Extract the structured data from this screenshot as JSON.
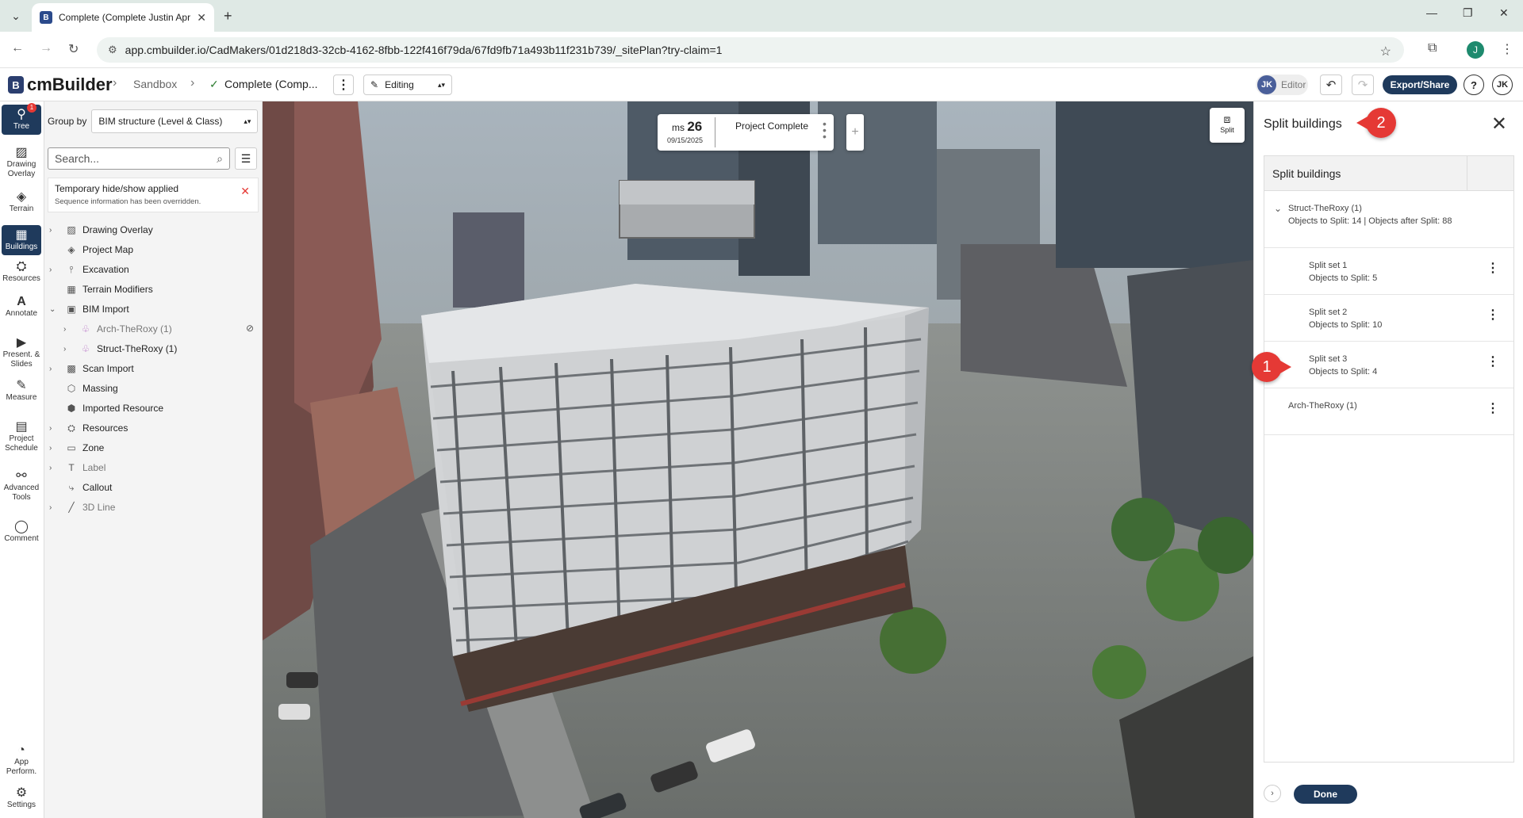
{
  "browser": {
    "tab_title": "Complete (Complete Justin Apr",
    "url": "app.cmbuilder.io/CadMakers/01d218d3-32cb-4162-8fbb-122f416f79da/67fd9fb71a493b11f231b739/_sitePlan?try-claim=1",
    "profile_initial": "J"
  },
  "app": {
    "logo_text": "cmBuilder",
    "logo_mark": "B",
    "breadcrumb": [
      "Sandbox",
      "Complete (Comp..."
    ],
    "mode": "Editing",
    "user_initials": "JK",
    "user_role": "Editor",
    "export_label": "Export/Share",
    "help_label": "?"
  },
  "rail": {
    "items": [
      {
        "label": "Tree",
        "badge": "1"
      },
      {
        "label": "Drawing Overlay"
      },
      {
        "label": "Terrain"
      },
      {
        "label": "Buildings"
      },
      {
        "label": "Resources"
      },
      {
        "label": "Annotate"
      },
      {
        "label": "Present. & Slides"
      },
      {
        "label": "Measure"
      },
      {
        "label": "Project Schedule"
      },
      {
        "label": "Advanced Tools"
      },
      {
        "label": "Comment"
      },
      {
        "label": "App Perform."
      },
      {
        "label": "Settings"
      }
    ]
  },
  "tree": {
    "group_by_label": "Group by",
    "group_by_value": "BIM structure (Level & Class)",
    "search_placeholder": "Search...",
    "notice_title": "Temporary hide/show applied",
    "notice_subtitle": "Sequence information has been overridden.",
    "rows": [
      {
        "label": "Drawing Overlay",
        "icon": "image-icon"
      },
      {
        "label": "Project Map",
        "icon": "layers-icon"
      },
      {
        "label": "Excavation",
        "icon": "shovel-icon"
      },
      {
        "label": "Terrain Modifiers",
        "icon": "grid-icon"
      },
      {
        "label": "BIM Import",
        "icon": "cube-icon"
      },
      {
        "label": "Arch-TheRoxy (1)",
        "icon": "model-icon"
      },
      {
        "label": "Struct-TheRoxy (1)",
        "icon": "model-icon"
      },
      {
        "label": "Scan Import",
        "icon": "scan-icon"
      },
      {
        "label": "Massing",
        "icon": "massing-icon"
      },
      {
        "label": "Imported Resource",
        "icon": "resource-icon"
      },
      {
        "label": "Resources",
        "icon": "resources-icon"
      },
      {
        "label": "Zone",
        "icon": "zone-icon"
      },
      {
        "label": "Label",
        "icon": "label-icon"
      },
      {
        "label": "Callout",
        "icon": "callout-icon"
      },
      {
        "label": "3D Line",
        "icon": "line-icon"
      }
    ]
  },
  "view": {
    "seq_prefix": "ms",
    "seq_number": "26",
    "seq_date": "09/15/2025",
    "seq_phase": "Project Complete",
    "split_label": "Split"
  },
  "split_panel": {
    "title": "Split buildings",
    "table_header": "Split buildings",
    "group_name": "Struct-TheRoxy (1)",
    "group_detail": "Objects to Split: 14 | Objects after Split: 88",
    "sets": [
      {
        "name": "Split set 1",
        "detail": "Objects to Split: 5"
      },
      {
        "name": "Split set 2",
        "detail": "Objects to Split: 10"
      },
      {
        "name": "Split set 3",
        "detail": "Objects to Split: 4"
      }
    ],
    "other_group": "Arch-TheRoxy (1)",
    "done_label": "Done"
  },
  "callouts": [
    "1",
    "2"
  ],
  "colors": {
    "accent": "#1f3a5c",
    "callout": "#e53935"
  }
}
